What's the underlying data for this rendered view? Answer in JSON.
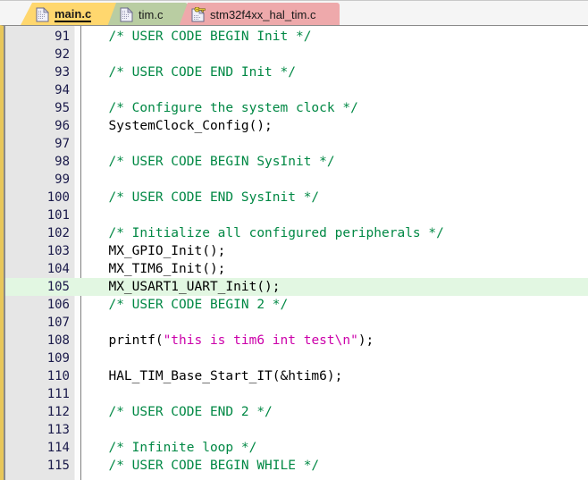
{
  "window": {
    "title": "main.c",
    "accent_color": "#ffd76e",
    "gutter_color": "#e6e6e6",
    "highlight_color": "#e2f7e2",
    "comment_color": "#008844",
    "string_color": "#cc00aa"
  },
  "tabs": [
    {
      "label": "main.c",
      "icon": "file-icon",
      "active": true,
      "color": "#ffd76e",
      "readonly": false
    },
    {
      "label": "tim.c",
      "icon": "file-icon",
      "active": false,
      "color": "#b9cda2",
      "readonly": false
    },
    {
      "label": "stm32f4xx_hal_tim.c",
      "icon": "file-locked-icon",
      "active": false,
      "color": "#eea9ab",
      "readonly": true
    }
  ],
  "editor": {
    "first_line": 91,
    "last_line": 115,
    "current_line": 105,
    "lines": [
      {
        "n": "91",
        "tokens": [
          {
            "t": "cmt",
            "s": "  /* USER CODE BEGIN Init */"
          }
        ]
      },
      {
        "n": "92",
        "tokens": [
          {
            "t": "plain",
            "s": ""
          }
        ]
      },
      {
        "n": "93",
        "tokens": [
          {
            "t": "cmt",
            "s": "  /* USER CODE END Init */"
          }
        ]
      },
      {
        "n": "94",
        "tokens": [
          {
            "t": "plain",
            "s": ""
          }
        ]
      },
      {
        "n": "95",
        "tokens": [
          {
            "t": "cmt",
            "s": "  /* Configure the system clock */"
          }
        ]
      },
      {
        "n": "96",
        "tokens": [
          {
            "t": "plain",
            "s": "  SystemClock_Config();"
          }
        ]
      },
      {
        "n": "97",
        "tokens": [
          {
            "t": "plain",
            "s": ""
          }
        ]
      },
      {
        "n": "98",
        "tokens": [
          {
            "t": "cmt",
            "s": "  /* USER CODE BEGIN SysInit */"
          }
        ]
      },
      {
        "n": "99",
        "tokens": [
          {
            "t": "plain",
            "s": ""
          }
        ]
      },
      {
        "n": "100",
        "tokens": [
          {
            "t": "cmt",
            "s": "  /* USER CODE END SysInit */"
          }
        ]
      },
      {
        "n": "101",
        "tokens": [
          {
            "t": "plain",
            "s": ""
          }
        ]
      },
      {
        "n": "102",
        "tokens": [
          {
            "t": "cmt",
            "s": "  /* Initialize all configured peripherals */"
          }
        ]
      },
      {
        "n": "103",
        "tokens": [
          {
            "t": "plain",
            "s": "  MX_GPIO_Init();"
          }
        ]
      },
      {
        "n": "104",
        "tokens": [
          {
            "t": "plain",
            "s": "  MX_TIM6_Init();"
          }
        ]
      },
      {
        "n": "105",
        "tokens": [
          {
            "t": "plain",
            "s": "  MX_USART1_UART_Init();"
          }
        ]
      },
      {
        "n": "106",
        "tokens": [
          {
            "t": "cmt",
            "s": "  /* USER CODE BEGIN 2 */"
          }
        ]
      },
      {
        "n": "107",
        "tokens": [
          {
            "t": "plain",
            "s": ""
          }
        ]
      },
      {
        "n": "108",
        "tokens": [
          {
            "t": "plain",
            "s": "  printf("
          },
          {
            "t": "str",
            "s": "\"this is tim6 int test\\n\""
          },
          {
            "t": "plain",
            "s": ");"
          }
        ]
      },
      {
        "n": "109",
        "tokens": [
          {
            "t": "plain",
            "s": ""
          }
        ]
      },
      {
        "n": "110",
        "tokens": [
          {
            "t": "plain",
            "s": "  HAL_TIM_Base_Start_IT(&htim6);"
          }
        ]
      },
      {
        "n": "111",
        "tokens": [
          {
            "t": "plain",
            "s": ""
          }
        ]
      },
      {
        "n": "112",
        "tokens": [
          {
            "t": "cmt",
            "s": "  /* USER CODE END 2 */"
          }
        ]
      },
      {
        "n": "113",
        "tokens": [
          {
            "t": "plain",
            "s": ""
          }
        ]
      },
      {
        "n": "114",
        "tokens": [
          {
            "t": "cmt",
            "s": "  /* Infinite loop */"
          }
        ]
      },
      {
        "n": "115",
        "tokens": [
          {
            "t": "cmt",
            "s": "  /* USER CODE BEGIN WHILE */"
          }
        ]
      }
    ]
  }
}
